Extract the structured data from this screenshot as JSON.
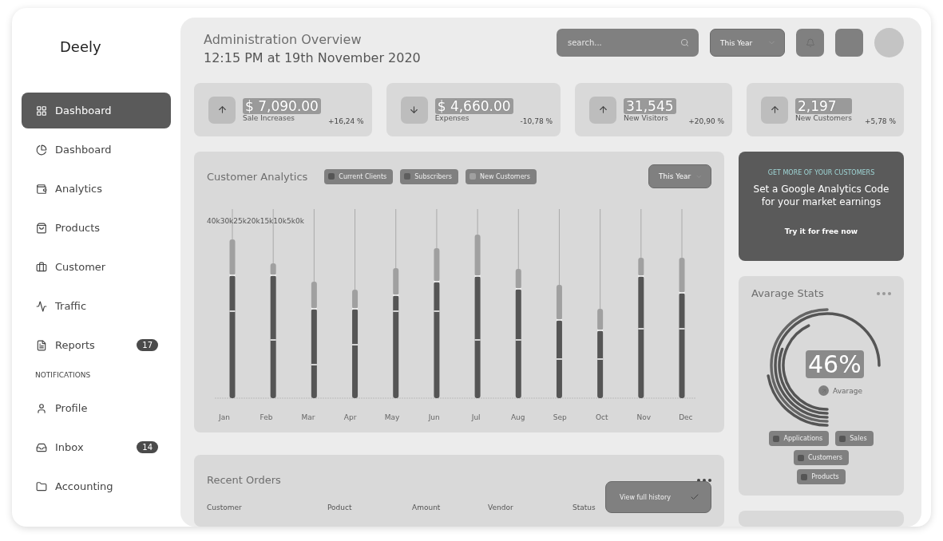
{
  "sidebar": {
    "logo": "Deely",
    "items": [
      {
        "label": "Dashboard",
        "selected": true
      },
      {
        "label": "Dashboard",
        "selected": false
      },
      {
        "label": "Analytics",
        "selected": false
      },
      {
        "label": "Products",
        "selected": false
      },
      {
        "label": "Customer",
        "selected": false
      },
      {
        "label": "Traffic",
        "selected": false
      },
      {
        "label": "Reports",
        "badge": "17",
        "selected": false
      }
    ],
    "section": "NOTIFICATIONS",
    "items2": [
      {
        "label": "Profile",
        "selected": false
      },
      {
        "label": "Inbox",
        "badge": "14",
        "selected": false
      },
      {
        "label": "Accounting",
        "selected": false
      }
    ]
  },
  "header": {
    "title": "Administration Overview",
    "subtitle": "12:15 PM at 19th November 2020",
    "search": {
      "placeholder": "search..."
    },
    "period": "This Year"
  },
  "stats": [
    {
      "kind": "up",
      "value": "$ 7,090.00",
      "label": "Sale Increases",
      "change": "+16,24 %"
    },
    {
      "kind": "down",
      "value": "$ 4,660.00",
      "label": "Expenses",
      "change": "-10,78 %"
    },
    {
      "kind": "up",
      "value": "31,545",
      "label": "New Visitors",
      "change": "+20,90 %"
    },
    {
      "kind": "up",
      "value": "2,197",
      "label": "New Customers",
      "change": "+5,78 %"
    }
  ],
  "analytics": {
    "title": "Customer Analytics",
    "legend": [
      {
        "label": "Current Clients",
        "color": "#555555"
      },
      {
        "label": "Subscribers",
        "color": "#5e5e5e"
      },
      {
        "label": "New Customers",
        "color": "#a0a0a0"
      }
    ],
    "period": "This Year",
    "y_axis_text": "40k30k25k20k15k10k5k0k",
    "months": [
      "Jan",
      "Feb",
      "Mar",
      "Apr",
      "May",
      "Jun",
      "Jul",
      "Aug",
      "Sep",
      "Oct",
      "Nov",
      "Dec"
    ]
  },
  "promo": {
    "eyebrow": "GET MORE OF YOUR CUSTOMERS",
    "heading": "Set a Google Analytics Code for your market earnings",
    "link": "Try it for free now"
  },
  "average": {
    "title": "Avarage Stats",
    "value": "46%",
    "caption": "Avarage",
    "legend": [
      "Applications",
      "Sales",
      "Customers",
      "Products"
    ]
  },
  "orders": {
    "title": "Recent Orders",
    "columns": [
      "Customer",
      "Poduct",
      "Amount",
      "Vendor",
      "Status"
    ],
    "action": "View full history"
  }
}
